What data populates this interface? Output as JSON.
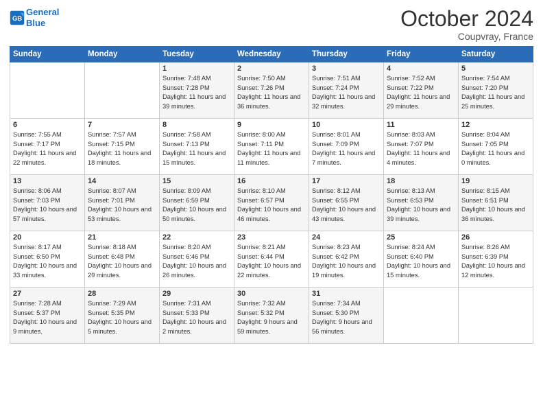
{
  "header": {
    "logo_line1": "General",
    "logo_line2": "Blue",
    "month": "October 2024",
    "location": "Coupvray, France"
  },
  "days_of_week": [
    "Sunday",
    "Monday",
    "Tuesday",
    "Wednesday",
    "Thursday",
    "Friday",
    "Saturday"
  ],
  "weeks": [
    [
      {
        "day": "",
        "sunrise": "",
        "sunset": "",
        "daylight": ""
      },
      {
        "day": "",
        "sunrise": "",
        "sunset": "",
        "daylight": ""
      },
      {
        "day": "1",
        "sunrise": "Sunrise: 7:48 AM",
        "sunset": "Sunset: 7:28 PM",
        "daylight": "Daylight: 11 hours and 39 minutes."
      },
      {
        "day": "2",
        "sunrise": "Sunrise: 7:50 AM",
        "sunset": "Sunset: 7:26 PM",
        "daylight": "Daylight: 11 hours and 36 minutes."
      },
      {
        "day": "3",
        "sunrise": "Sunrise: 7:51 AM",
        "sunset": "Sunset: 7:24 PM",
        "daylight": "Daylight: 11 hours and 32 minutes."
      },
      {
        "day": "4",
        "sunrise": "Sunrise: 7:52 AM",
        "sunset": "Sunset: 7:22 PM",
        "daylight": "Daylight: 11 hours and 29 minutes."
      },
      {
        "day": "5",
        "sunrise": "Sunrise: 7:54 AM",
        "sunset": "Sunset: 7:20 PM",
        "daylight": "Daylight: 11 hours and 25 minutes."
      }
    ],
    [
      {
        "day": "6",
        "sunrise": "Sunrise: 7:55 AM",
        "sunset": "Sunset: 7:17 PM",
        "daylight": "Daylight: 11 hours and 22 minutes."
      },
      {
        "day": "7",
        "sunrise": "Sunrise: 7:57 AM",
        "sunset": "Sunset: 7:15 PM",
        "daylight": "Daylight: 11 hours and 18 minutes."
      },
      {
        "day": "8",
        "sunrise": "Sunrise: 7:58 AM",
        "sunset": "Sunset: 7:13 PM",
        "daylight": "Daylight: 11 hours and 15 minutes."
      },
      {
        "day": "9",
        "sunrise": "Sunrise: 8:00 AM",
        "sunset": "Sunset: 7:11 PM",
        "daylight": "Daylight: 11 hours and 11 minutes."
      },
      {
        "day": "10",
        "sunrise": "Sunrise: 8:01 AM",
        "sunset": "Sunset: 7:09 PM",
        "daylight": "Daylight: 11 hours and 7 minutes."
      },
      {
        "day": "11",
        "sunrise": "Sunrise: 8:03 AM",
        "sunset": "Sunset: 7:07 PM",
        "daylight": "Daylight: 11 hours and 4 minutes."
      },
      {
        "day": "12",
        "sunrise": "Sunrise: 8:04 AM",
        "sunset": "Sunset: 7:05 PM",
        "daylight": "Daylight: 11 hours and 0 minutes."
      }
    ],
    [
      {
        "day": "13",
        "sunrise": "Sunrise: 8:06 AM",
        "sunset": "Sunset: 7:03 PM",
        "daylight": "Daylight: 10 hours and 57 minutes."
      },
      {
        "day": "14",
        "sunrise": "Sunrise: 8:07 AM",
        "sunset": "Sunset: 7:01 PM",
        "daylight": "Daylight: 10 hours and 53 minutes."
      },
      {
        "day": "15",
        "sunrise": "Sunrise: 8:09 AM",
        "sunset": "Sunset: 6:59 PM",
        "daylight": "Daylight: 10 hours and 50 minutes."
      },
      {
        "day": "16",
        "sunrise": "Sunrise: 8:10 AM",
        "sunset": "Sunset: 6:57 PM",
        "daylight": "Daylight: 10 hours and 46 minutes."
      },
      {
        "day": "17",
        "sunrise": "Sunrise: 8:12 AM",
        "sunset": "Sunset: 6:55 PM",
        "daylight": "Daylight: 10 hours and 43 minutes."
      },
      {
        "day": "18",
        "sunrise": "Sunrise: 8:13 AM",
        "sunset": "Sunset: 6:53 PM",
        "daylight": "Daylight: 10 hours and 39 minutes."
      },
      {
        "day": "19",
        "sunrise": "Sunrise: 8:15 AM",
        "sunset": "Sunset: 6:51 PM",
        "daylight": "Daylight: 10 hours and 36 minutes."
      }
    ],
    [
      {
        "day": "20",
        "sunrise": "Sunrise: 8:17 AM",
        "sunset": "Sunset: 6:50 PM",
        "daylight": "Daylight: 10 hours and 33 minutes."
      },
      {
        "day": "21",
        "sunrise": "Sunrise: 8:18 AM",
        "sunset": "Sunset: 6:48 PM",
        "daylight": "Daylight: 10 hours and 29 minutes."
      },
      {
        "day": "22",
        "sunrise": "Sunrise: 8:20 AM",
        "sunset": "Sunset: 6:46 PM",
        "daylight": "Daylight: 10 hours and 26 minutes."
      },
      {
        "day": "23",
        "sunrise": "Sunrise: 8:21 AM",
        "sunset": "Sunset: 6:44 PM",
        "daylight": "Daylight: 10 hours and 22 minutes."
      },
      {
        "day": "24",
        "sunrise": "Sunrise: 8:23 AM",
        "sunset": "Sunset: 6:42 PM",
        "daylight": "Daylight: 10 hours and 19 minutes."
      },
      {
        "day": "25",
        "sunrise": "Sunrise: 8:24 AM",
        "sunset": "Sunset: 6:40 PM",
        "daylight": "Daylight: 10 hours and 15 minutes."
      },
      {
        "day": "26",
        "sunrise": "Sunrise: 8:26 AM",
        "sunset": "Sunset: 6:39 PM",
        "daylight": "Daylight: 10 hours and 12 minutes."
      }
    ],
    [
      {
        "day": "27",
        "sunrise": "Sunrise: 7:28 AM",
        "sunset": "Sunset: 5:37 PM",
        "daylight": "Daylight: 10 hours and 9 minutes."
      },
      {
        "day": "28",
        "sunrise": "Sunrise: 7:29 AM",
        "sunset": "Sunset: 5:35 PM",
        "daylight": "Daylight: 10 hours and 5 minutes."
      },
      {
        "day": "29",
        "sunrise": "Sunrise: 7:31 AM",
        "sunset": "Sunset: 5:33 PM",
        "daylight": "Daylight: 10 hours and 2 minutes."
      },
      {
        "day": "30",
        "sunrise": "Sunrise: 7:32 AM",
        "sunset": "Sunset: 5:32 PM",
        "daylight": "Daylight: 9 hours and 59 minutes."
      },
      {
        "day": "31",
        "sunrise": "Sunrise: 7:34 AM",
        "sunset": "Sunset: 5:30 PM",
        "daylight": "Daylight: 9 hours and 56 minutes."
      },
      {
        "day": "",
        "sunrise": "",
        "sunset": "",
        "daylight": ""
      },
      {
        "day": "",
        "sunrise": "",
        "sunset": "",
        "daylight": ""
      }
    ]
  ]
}
